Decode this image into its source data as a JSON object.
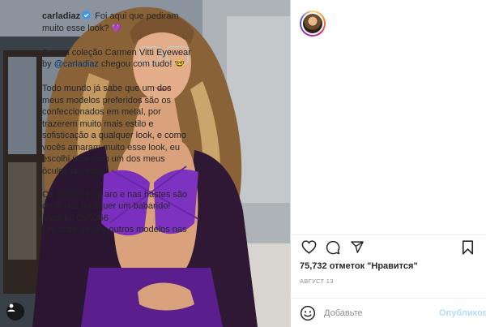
{
  "post": {
    "username": "carladiaz",
    "headline": "Foi aqui que pediram muito esse look?",
    "headline_emoji": "💜",
    "caption": [
      {
        "text_before": "A nova coleção Carmen Vitti Eyewear by ",
        "mention": "@carladiaz",
        "text_after": " chegou com tudo! ",
        "emoji": "🤓"
      },
      {
        "text": "Todo mundo já sabe que um dos meus modelos preferidos são os confeccionados em metal, por trazerem muito mais estilo e sofisticação a qualquer look, e como vocês amaram muito esse look, eu escolhi usar com um dos meus óculos favoritos."
      },
      {
        "text": "Os detalhes no aro e nas hastes são de deixar qualquer um babando!\nModelo: CV0256\nEncontre esse e outros modelos nas"
      }
    ]
  },
  "actions": {
    "like_icon": "heart-icon",
    "comment_icon": "comment-icon",
    "share_icon": "paper-plane-icon",
    "save_icon": "bookmark-icon"
  },
  "likes_text": "75,732 отметок \"Нравится\"",
  "date_text": "АВГУСТ 13",
  "comment": {
    "placeholder": "Добавьте",
    "publish_label": "Опубликовать",
    "emoji_icon": "smiley-icon"
  },
  "colors": {
    "verified_blue": "#3897f0",
    "link_blue": "#00376b",
    "publish_disabled": "#b2dffc",
    "muted_gray": "#8e8e8e",
    "top_purple": "#7b2fbe"
  }
}
